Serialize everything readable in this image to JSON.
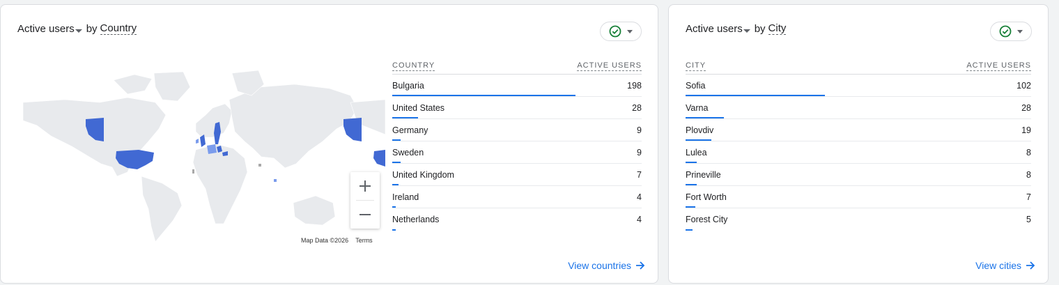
{
  "colors": {
    "accent": "#1a73e8",
    "map_fill": "#e8eaed",
    "map_high": "#4169d3",
    "map_mid": "#7b9cec",
    "map_low": "#a9a9a9",
    "check": "#188038"
  },
  "country_card": {
    "metric_label": "Active users",
    "by_label": "by",
    "dimension_label": "Country",
    "compare_icon": "check-circle-icon",
    "table": {
      "col_dimension": "COUNTRY",
      "col_metric": "ACTIVE USERS",
      "rows": [
        {
          "name": "Bulgaria",
          "value": "198",
          "fraction": 1.0
        },
        {
          "name": "United States",
          "value": "28",
          "fraction": 0.1414
        },
        {
          "name": "Germany",
          "value": "9",
          "fraction": 0.0455
        },
        {
          "name": "Sweden",
          "value": "9",
          "fraction": 0.0455
        },
        {
          "name": "United Kingdom",
          "value": "7",
          "fraction": 0.0354
        },
        {
          "name": "Ireland",
          "value": "4",
          "fraction": 0.0202
        },
        {
          "name": "Netherlands",
          "value": "4",
          "fraction": 0.0202
        }
      ]
    },
    "map": {
      "zoom_in_icon": "plus-icon",
      "zoom_out_icon": "minus-icon",
      "attribution": "Map Data ©2026",
      "terms": "Terms"
    },
    "view_link": "View countries"
  },
  "city_card": {
    "metric_label": "Active users",
    "by_label": "by",
    "dimension_label": "City",
    "compare_icon": "check-circle-icon",
    "table": {
      "col_dimension": "CITY",
      "col_metric": "ACTIVE USERS",
      "rows": [
        {
          "name": "Sofia",
          "value": "102",
          "fraction": 1.0
        },
        {
          "name": "Varna",
          "value": "28",
          "fraction": 0.2745
        },
        {
          "name": "Plovdiv",
          "value": "19",
          "fraction": 0.1863
        },
        {
          "name": "Lulea",
          "value": "8",
          "fraction": 0.0784
        },
        {
          "name": "Prineville",
          "value": "8",
          "fraction": 0.0784
        },
        {
          "name": "Fort Worth",
          "value": "7",
          "fraction": 0.0686
        },
        {
          "name": "Forest City",
          "value": "5",
          "fraction": 0.049
        }
      ]
    },
    "view_link": "View cities"
  }
}
